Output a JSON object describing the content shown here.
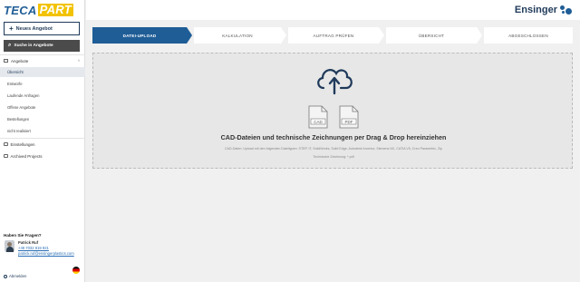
{
  "brand": {
    "logo_part1": "TECA",
    "logo_part2": "PART",
    "company": "Ensinger"
  },
  "sidebar": {
    "new_offer": "Neues Angebot",
    "search": "Suche in Angebote",
    "section": "Angebote",
    "sub_items": [
      "Übersicht",
      "Entwürfe",
      "Laufende Anfragen",
      "Offene Angebote",
      "Bestellungen",
      "nicht realisiert"
    ],
    "main_items": [
      "Einstellungen",
      "Archived Projects"
    ],
    "help_title": "Haben Sie Fragen?",
    "contact_name": "Patrick Ruf",
    "contact_phone": "+49 7032 819 921",
    "contact_email": "patrick.ruf@ensingerplastics.com",
    "logout": "Abmelden"
  },
  "steps": [
    "DATEI-UPLOAD",
    "KALKULATION",
    "AUFTRAG PRÜFEN",
    "ÜBERSICHT",
    "ABGESCHLOSSEN"
  ],
  "upload": {
    "file_labels": [
      "CAD",
      "PDF"
    ],
    "title": "CAD-Dateien und technische Zeichnungen per Drag & Drop hereinziehen",
    "hint_formats": "CAD-Daten: Upload mit den folgenden Dateitypen: STEP, IT, SolidWorks, Solid Edge, Autodesk Inventor, Siemens NX, CATIA V5, Creo Parametric, Zip",
    "hint_drawing": "Technische Zeichnung: *.pdf"
  },
  "colors": {
    "primary": "#1f5d96",
    "accent": "#f2c300",
    "dark": "#4b4b4b"
  }
}
